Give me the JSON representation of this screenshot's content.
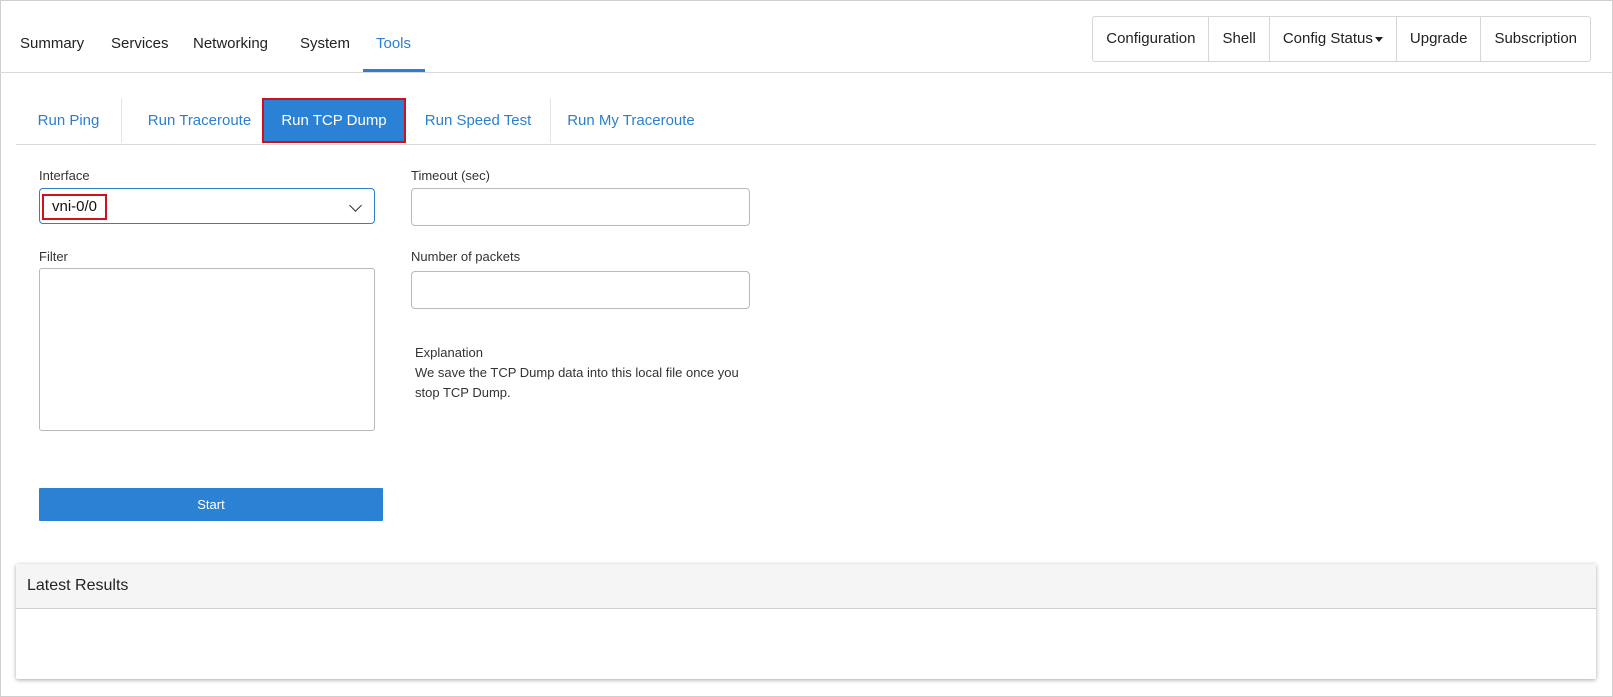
{
  "nav": {
    "tabs": [
      {
        "label": "Summary"
      },
      {
        "label": "Services"
      },
      {
        "label": "Networking"
      },
      {
        "label": "System"
      },
      {
        "label": "Tools"
      }
    ],
    "active_tab": "Tools"
  },
  "actions": {
    "configuration": "Configuration",
    "shell": "Shell",
    "config_status": "Config Status",
    "upgrade": "Upgrade",
    "subscription": "Subscription"
  },
  "subtabs": [
    {
      "label": "Run Ping"
    },
    {
      "label": "Run Traceroute"
    },
    {
      "label": "Run TCP Dump"
    },
    {
      "label": "Run Speed Test"
    },
    {
      "label": "Run My Traceroute"
    }
  ],
  "form": {
    "interface_label": "Interface",
    "interface_value": "vni-0/0",
    "filter_label": "Filter",
    "filter_value": "",
    "timeout_label": "Timeout (sec)",
    "timeout_value": "",
    "packets_label": "Number of packets",
    "packets_value": "",
    "explanation_title": "Explanation",
    "explanation_body": "We save the TCP Dump data into this local file once you stop TCP Dump.",
    "start_label": "Start"
  },
  "results": {
    "title": "Latest Results"
  },
  "colors": {
    "accent": "#2b82d4",
    "highlight": "#d0101a"
  }
}
